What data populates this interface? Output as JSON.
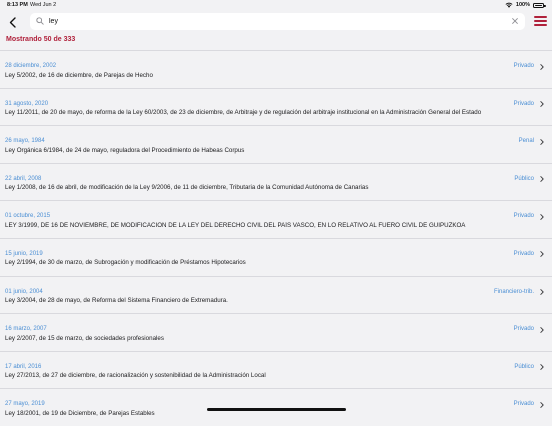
{
  "status_bar": {
    "time": "8:13 PM",
    "date": "Wed Jun 2",
    "battery": "100%"
  },
  "search": {
    "value": "ley",
    "placeholder": ""
  },
  "result_count": "Mostrando 50 de 333",
  "colors": {
    "accent": "#b0213b",
    "link": "#4a8ed4",
    "background": "#f2f2f4"
  },
  "items": [
    {
      "date": "28 diciembre, 2002",
      "category": "Privado",
      "title": "Ley 5/2002, de 16 de diciembre, de Parejas de Hecho"
    },
    {
      "date": "31 agosto, 2020",
      "category": "Privado",
      "title": "Ley 11/2011, de 20 de mayo, de reforma de la Ley 60/2003, de 23 de diciembre, de Arbitraje y de regulación del arbitraje institucional en la Administración General del Estado"
    },
    {
      "date": "26 mayo, 1984",
      "category": "Penal",
      "title": "Ley Orgánica 6/1984, de 24 de mayo, reguladora del Procedimiento de Habeas Corpus"
    },
    {
      "date": "22 abril, 2008",
      "category": "Público",
      "title": "Ley 1/2008, de 16 de abril, de modificación de la Ley 9/2006, de 11 de diciembre, Tributaria de la Comunidad Autónoma de Canarias"
    },
    {
      "date": "01 octubre, 2015",
      "category": "Privado",
      "title": "LEY 3/1999, DE 16 DE NOVIEMBRE, DE MODIFICACIÓN DE LA LEY DEL DERECHO CIVIL DEL PAÍS VASCO, EN LO RELATIVO AL FUERO CIVIL DE GUIPUZKOA"
    },
    {
      "date": "15 junio, 2019",
      "category": "Privado",
      "title": "Ley 2/1994, de 30 de marzo, de Subrogación y modificación de Préstamos Hipotecarios"
    },
    {
      "date": "01 junio, 2004",
      "category": "Financiero-trib.",
      "title": "Ley 3/2004, de 28 de mayo, de Reforma del Sistema Financiero de Extremadura."
    },
    {
      "date": "16 marzo, 2007",
      "category": "Privado",
      "title": "Ley 2/2007, de 15 de marzo, de sociedades profesionales"
    },
    {
      "date": "17 abril, 2016",
      "category": "Público",
      "title": "Ley 27/2013, de 27 de diciembre, de racionalización y sostenibilidad de la Administración Local"
    },
    {
      "date": "27 mayo, 2019",
      "category": "Privado",
      "title": "Ley 18/2001, de 19 de Diciembre, de Parejas Estables"
    }
  ]
}
